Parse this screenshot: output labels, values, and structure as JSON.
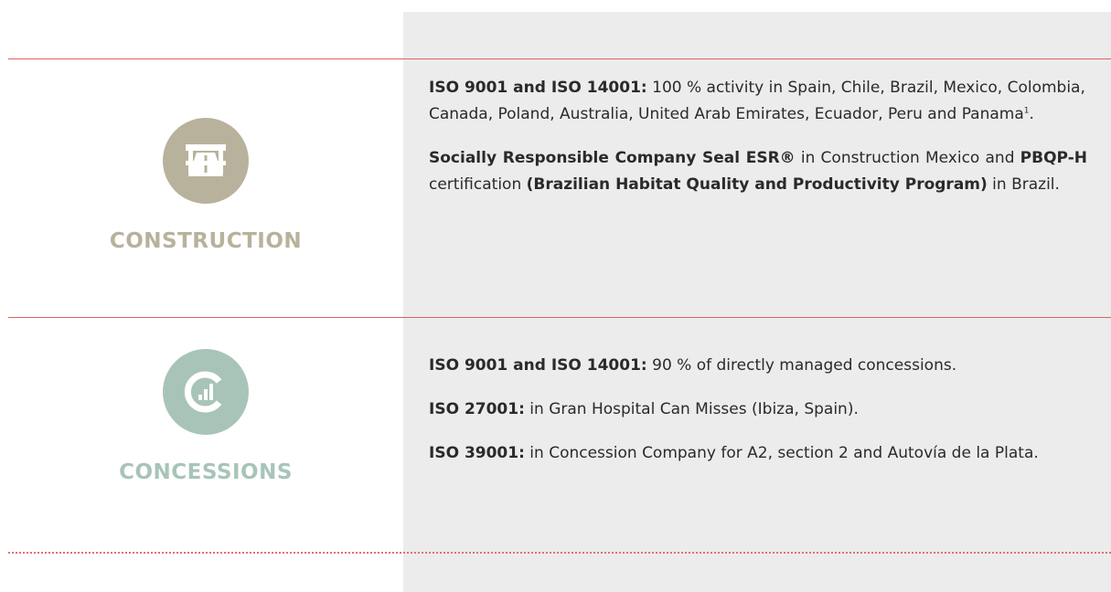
{
  "colors": {
    "construction_accent": "#b8b29c",
    "concessions_accent": "#a8c4b8",
    "rule": "#e06060",
    "panel": "#ececec"
  },
  "construction": {
    "icon": "highway-icon",
    "label": "CONSTRUCTION",
    "p1": {
      "b1": "ISO 9001 and ISO 14001:",
      "t1": " 100 % activity in Spain, Chile, Brazil, Mexico, Colombia, Canada, Poland, Australia, United Arab Emirates, Ecuador, Peru and Panama",
      "sup": "1",
      "t2": "."
    },
    "p2": {
      "b1": "Socially Responsible Company Seal ESR®",
      "t1": " in Construction Mexico and ",
      "b2": "PBQP-H",
      "t2": " certification ",
      "b3": "(Brazilian Habitat Quality and Productivity Program)",
      "t3": " in Brazil."
    }
  },
  "concessions": {
    "icon": "concession-chart-icon",
    "label": "CONCESSIONS",
    "p1": {
      "b1": "ISO 9001 and ISO 14001:",
      "t1": " 90 % of directly managed concessions."
    },
    "p2": {
      "b1": "ISO 27001:",
      "t1": " in Gran Hospital Can Misses (Ibiza, Spain)."
    },
    "p3": {
      "b1": "ISO 39001:",
      "t1": " in Concession Company for A2, section 2 and Autovía de la Plata."
    }
  }
}
